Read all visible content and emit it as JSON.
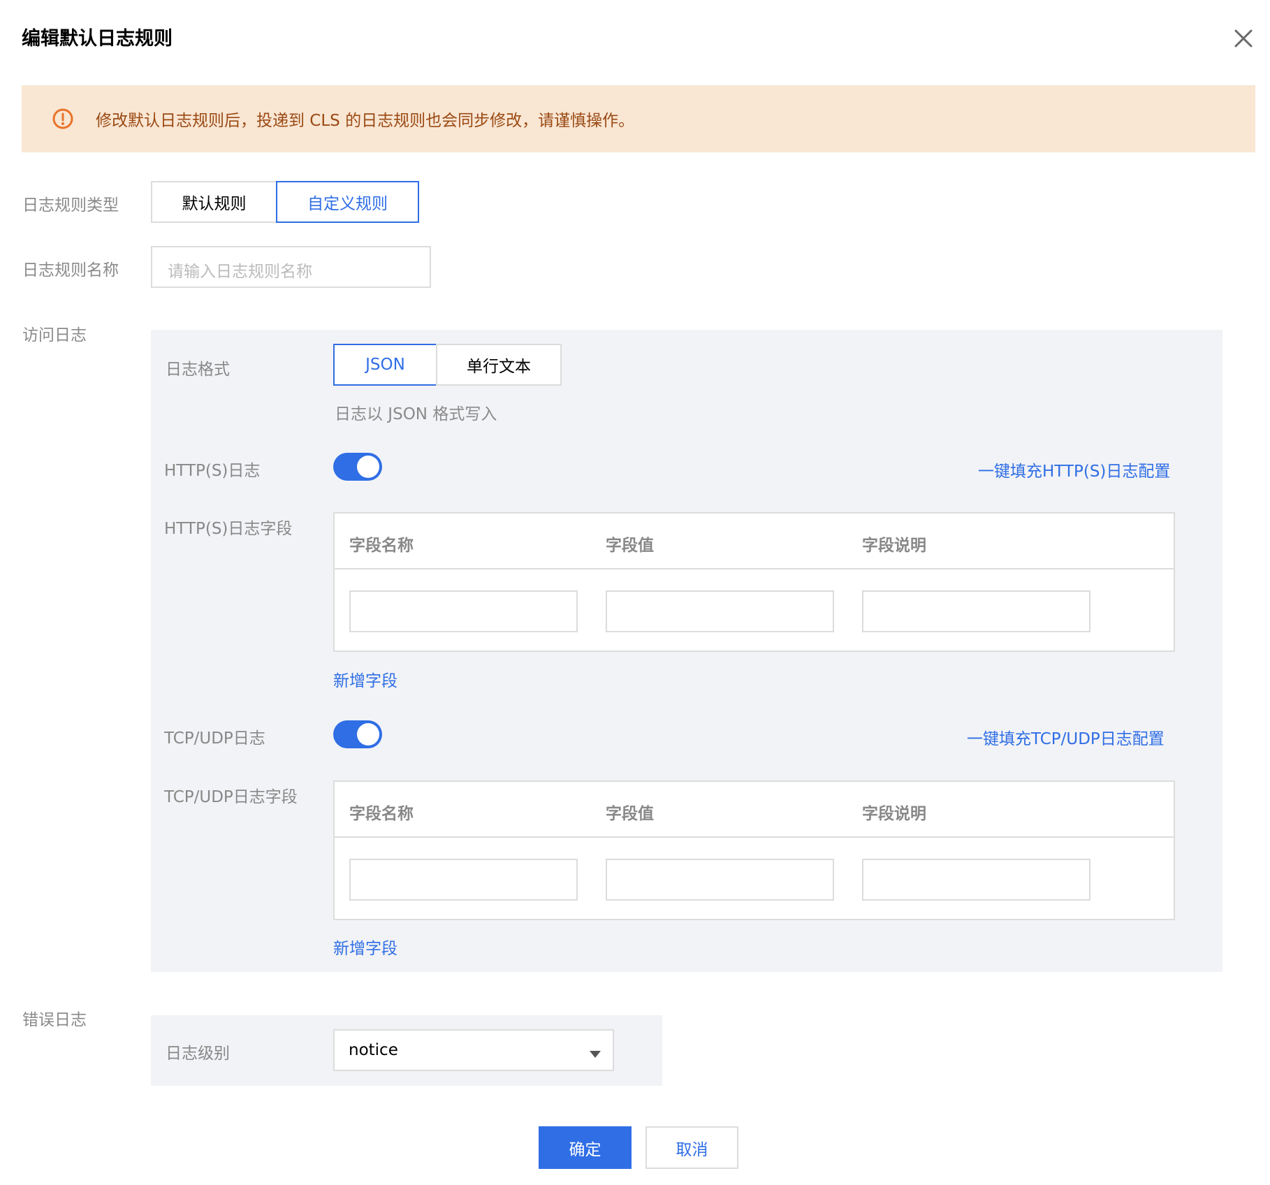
{
  "dialog": {
    "title": "编辑默认日志规则"
  },
  "alert": {
    "text": "修改默认日志规则后，投递到 CLS 的日志规则也会同步修改，请谨慎操作。"
  },
  "rule_type": {
    "label": "日志规则类型",
    "options": [
      "默认规则",
      "自定义规则"
    ],
    "selected": "自定义规则"
  },
  "rule_name": {
    "label": "日志规则名称",
    "placeholder": "请输入日志规则名称",
    "value": ""
  },
  "access_log": {
    "label": "访问日志",
    "format": {
      "label": "日志格式",
      "options": [
        "JSON",
        "单行文本"
      ],
      "selected": "JSON",
      "hint": "日志以 JSON 格式写入"
    },
    "http": {
      "toggle_label": "HTTP(S)日志",
      "enabled": true,
      "fill_link": "一键填充HTTP(S)日志配置",
      "fields_label": "HTTP(S)日志字段",
      "columns": [
        "字段名称",
        "字段值",
        "字段说明"
      ],
      "add_field": "新增字段"
    },
    "tcp": {
      "toggle_label": "TCP/UDP日志",
      "enabled": true,
      "fill_link": "一键填充TCP/UDP日志配置",
      "fields_label": "TCP/UDP日志字段",
      "columns": [
        "字段名称",
        "字段值",
        "字段说明"
      ],
      "add_field": "新增字段"
    }
  },
  "error_log": {
    "label": "错误日志",
    "level": {
      "label": "日志级别",
      "value": "notice"
    }
  },
  "footer": {
    "confirm": "确定",
    "cancel": "取消"
  },
  "colors": {
    "primary": "#2f6ee5",
    "alert_bg": "#f9e6d3",
    "alert_text": "#9a4a14",
    "alert_icon": "#e8742a",
    "panel_bg": "#f2f3f6"
  },
  "icons": {
    "close": "close-icon",
    "alert": "warning-icon",
    "dropdown": "caret-down-icon"
  }
}
